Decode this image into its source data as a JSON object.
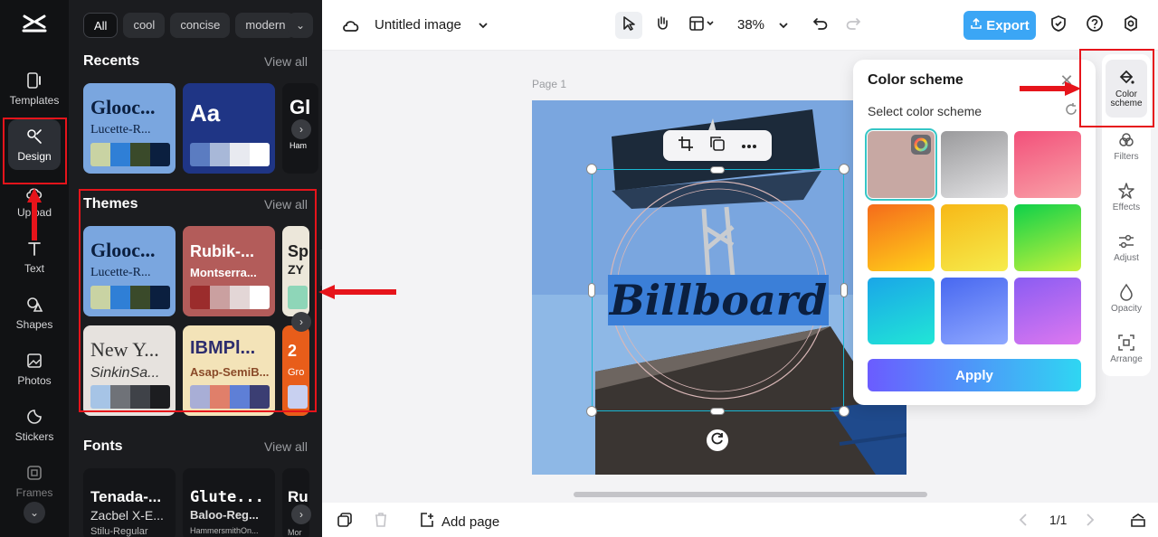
{
  "app": {
    "logo": "CapCut",
    "document_title": "Untitled image"
  },
  "rail": {
    "items": [
      {
        "label": "Templates"
      },
      {
        "label": "Design"
      },
      {
        "label": "Upload"
      },
      {
        "label": "Text"
      },
      {
        "label": "Shapes"
      },
      {
        "label": "Photos"
      },
      {
        "label": "Stickers"
      },
      {
        "label": "Frames"
      }
    ]
  },
  "panel": {
    "chips": [
      "All",
      "cool",
      "concise",
      "modern"
    ],
    "recents": {
      "title": "Recents",
      "view_all": "View all",
      "cards": [
        {
          "t1": "Glooc...",
          "t2": "Lucette-R...",
          "bg": "#7aa6df",
          "fg": "#0b1f3f",
          "swatches": [
            "#c9d3a3",
            "#2f7fd6",
            "#3a4a2a",
            "#0b1f3f"
          ]
        },
        {
          "t1": "Aa",
          "t2": "",
          "bg": "#1f3585",
          "fg": "#ffffff",
          "swatches": [
            "#5b7cc1",
            "#a8b8d8",
            "#e8eaf0",
            "#ffffff"
          ]
        },
        {
          "t1": "Gl",
          "t2": "Ham",
          "bg": "#141518",
          "fg": "#ffffff",
          "swatches": []
        }
      ]
    },
    "themes": {
      "title": "Themes",
      "view_all": "View all",
      "cards": [
        {
          "t1": "Glooc...",
          "t2": "Lucette-R...",
          "bg": "#7aa6df",
          "fg": "#0b1f3f",
          "swatches": [
            "#c9d3a3",
            "#2f7fd6",
            "#3a4a2a",
            "#0b1f3f"
          ]
        },
        {
          "t1": "Rubik-...",
          "t2": "Montserra...",
          "bg": "#b35c5a",
          "fg": "#ffffff",
          "swatches": [
            "#9b2c2c",
            "#caa0a0",
            "#e3d6d6",
            "#ffffff"
          ]
        },
        {
          "t1": "Sp",
          "t2": "ZY",
          "bg": "#ece7da",
          "fg": "#222222",
          "swatches": [
            "#8ed6b8"
          ]
        },
        {
          "t1": "New Y...",
          "t2": "SinkinSa...",
          "bg": "#e6e2de",
          "fg": "#333333",
          "swatches": [
            "#a6c4e6",
            "#6f7278",
            "#3f4248",
            "#1c1d20"
          ]
        },
        {
          "t1": "IBMPl...",
          "t2": "Asap-SemiB...",
          "bg": "#f3e3b8",
          "fg": "#2d2d6e",
          "swatches": [
            "#a8aed6",
            "#e07f6a",
            "#5e7fd6",
            "#3b3e73"
          ]
        },
        {
          "t1": "2",
          "t2": "Gro",
          "bg": "#e85d1a",
          "fg": "#ffffff",
          "swatches": [
            "#c8d0f0"
          ]
        }
      ]
    },
    "fonts": {
      "title": "Fonts",
      "view_all": "View all",
      "cards": [
        {
          "t1": "Tenada-...",
          "t2": "Zacbel X-E...",
          "t3": "Stilu-Regular"
        },
        {
          "t1": "Glute...",
          "t2": "Baloo-Reg...",
          "t3": "HammersmithOn..."
        },
        {
          "t1": "Ru",
          "t2": "",
          "t3": "Mor"
        }
      ]
    }
  },
  "topbar": {
    "zoom": "38%",
    "export_label": "Export"
  },
  "canvas": {
    "page_label": "Page 1",
    "text_element": "Billboard"
  },
  "bottombar": {
    "add_page_label": "Add page",
    "page_indicator": "1/1"
  },
  "color_scheme": {
    "title": "Color scheme",
    "subtitle": "Select color scheme",
    "apply_label": "Apply",
    "swatches": [
      {
        "name": "dusty-rose",
        "colors": [
          "#c7a8a3",
          "#c7a8a3"
        ],
        "selected": true
      },
      {
        "name": "gray",
        "colors": [
          "#9a9a9c",
          "#e2e2e4"
        ],
        "selected": false
      },
      {
        "name": "pink-red",
        "colors": [
          "#f2507a",
          "#f9a2a8"
        ],
        "selected": false
      },
      {
        "name": "orange",
        "colors": [
          "#f56b1b",
          "#ffd21a"
        ],
        "selected": false
      },
      {
        "name": "yellow",
        "colors": [
          "#f7b817",
          "#f6ec4c"
        ],
        "selected": false
      },
      {
        "name": "green",
        "colors": [
          "#0dd04a",
          "#c6f23a"
        ],
        "selected": false
      },
      {
        "name": "cyan",
        "colors": [
          "#1aa6e8",
          "#21e6d6"
        ],
        "selected": false
      },
      {
        "name": "blue",
        "colors": [
          "#4868f0",
          "#8fa8ff"
        ],
        "selected": false
      },
      {
        "name": "purple",
        "colors": [
          "#8a5cf2",
          "#dd78f0"
        ],
        "selected": false
      }
    ]
  },
  "right_tools": {
    "items": [
      {
        "label": "Color scheme"
      },
      {
        "label": "Filters"
      },
      {
        "label": "Effects"
      },
      {
        "label": "Adjust"
      },
      {
        "label": "Opacity"
      },
      {
        "label": "Arrange"
      }
    ]
  },
  "colors": {
    "accent": "#3ba6f5",
    "annotation_red": "#e6141b",
    "selection": "#1ab8d3"
  }
}
